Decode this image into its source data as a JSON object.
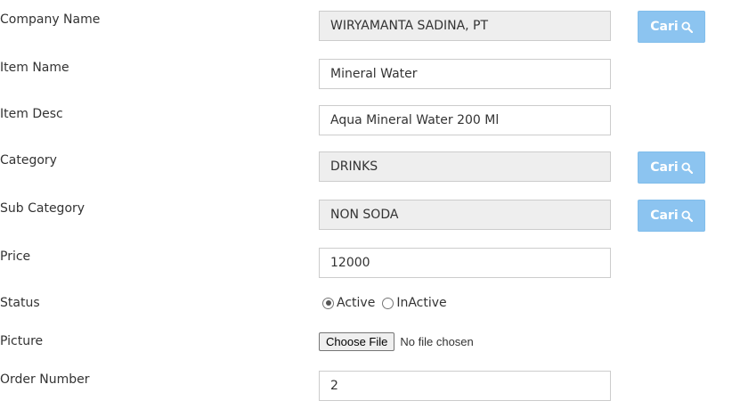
{
  "form": {
    "company": {
      "label": "Company Name",
      "value": "WIRYAMANTA SADINA, PT"
    },
    "item_name": {
      "label": "Item Name",
      "value": "Mineral Water"
    },
    "item_desc": {
      "label": "Item Desc",
      "value": "Aqua Mineral Water 200 Ml"
    },
    "category": {
      "label": "Category",
      "value": "DRINKS"
    },
    "sub_category": {
      "label": "Sub Category",
      "value": "NON SODA"
    },
    "price": {
      "label": "Price",
      "value": "12000"
    },
    "status": {
      "label": "Status",
      "options": [
        "Active",
        "InActive"
      ],
      "selected": "Active"
    },
    "picture": {
      "label": "Picture",
      "button_label": "Choose File",
      "file_status": "No file chosen"
    },
    "order_number": {
      "label": "Order Number",
      "value": "2"
    }
  },
  "search_button": {
    "label": "Cari",
    "icon": "search-icon"
  },
  "colors": {
    "button_bg": "#8cc4f0",
    "readonly_bg": "#eeeeee",
    "border": "#cccccc"
  }
}
